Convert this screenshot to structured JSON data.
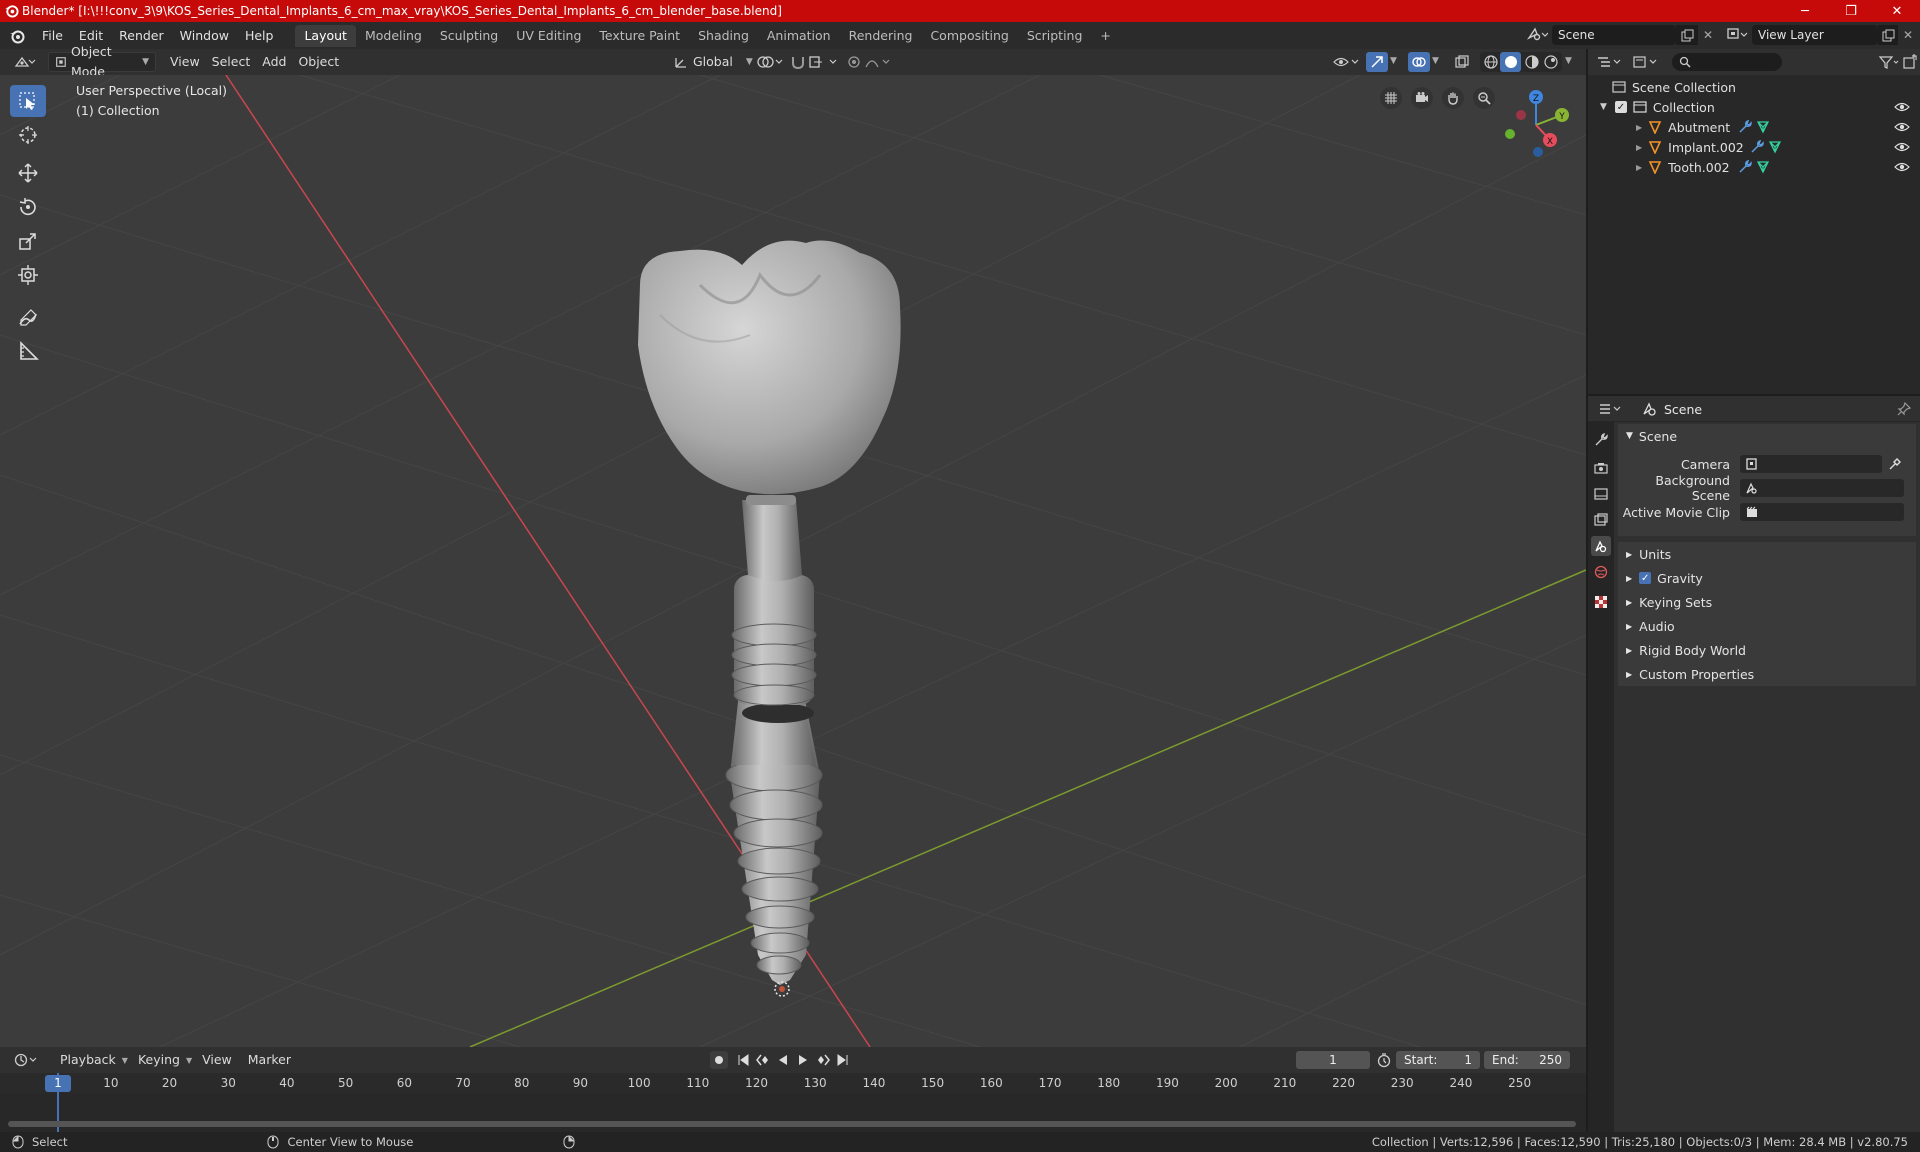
{
  "window": {
    "title": "Blender* [I:\\!!!conv_3\\9\\KOS_Series_Dental_Implants_6_cm_max_vray\\KOS_Series_Dental_Implants_6_cm_blender_base.blend]",
    "minimize": "─",
    "maximize": "❐",
    "close": "✕"
  },
  "menubar": {
    "items": [
      "File",
      "Edit",
      "Render",
      "Window",
      "Help"
    ],
    "workspaces": [
      "Layout",
      "Modeling",
      "Sculpting",
      "UV Editing",
      "Texture Paint",
      "Shading",
      "Animation",
      "Rendering",
      "Compositing",
      "Scripting"
    ],
    "active_workspace": "Layout",
    "add_workspace": "+",
    "scene_label": "Scene",
    "view_layer_label": "View Layer"
  },
  "viewport_header": {
    "mode": "Object Mode",
    "menus": [
      "View",
      "Select",
      "Add",
      "Object"
    ],
    "transform_orientation": "Global"
  },
  "viewport": {
    "perspective_label": "User Perspective (Local)",
    "collection_label": "(1) Collection",
    "gizmo": {
      "z": "Z",
      "y": "Y",
      "x": "X"
    }
  },
  "outliner": {
    "root": "Scene Collection",
    "collection": "Collection",
    "objects": [
      "Abutment",
      "Implant.002",
      "Tooth.002"
    ]
  },
  "properties": {
    "context": "Scene",
    "panel_title": "Scene",
    "fields": [
      {
        "label": "Camera"
      },
      {
        "label": "Background Scene"
      },
      {
        "label": "Active Movie Clip"
      }
    ],
    "sections": [
      "Units",
      "Gravity",
      "Keying Sets",
      "Audio",
      "Rigid Body World",
      "Custom Properties"
    ],
    "gravity_enabled": true
  },
  "timeline": {
    "menus": [
      "Playback",
      "Keying",
      "View",
      "Marker"
    ],
    "current_frame": "1",
    "start_label": "Start:",
    "start": "1",
    "end_label": "End:",
    "end": "250",
    "ticks": [
      "1",
      "10",
      "20",
      "30",
      "40",
      "50",
      "60",
      "70",
      "80",
      "90",
      "100",
      "110",
      "120",
      "130",
      "140",
      "150",
      "160",
      "170",
      "180",
      "190",
      "200",
      "210",
      "220",
      "230",
      "240",
      "250"
    ]
  },
  "statusbar": {
    "left_hint": "Select",
    "mid_hint": "Center View to Mouse",
    "stats": "Collection | Verts:12,596 | Faces:12,590 | Tris:25,180 | Objects:0/3 | Mem: 28.4 MB | v2.80.75"
  },
  "colors": {
    "title_bar": "#c60a0a",
    "accent": "#4772b3",
    "x_axis": "#e74c5c",
    "y_axis": "#8ab534",
    "z_axis": "#3f86e0",
    "object_icon": "#f1922a",
    "modifier_icon": "#5b9be0",
    "mesh_icon": "#33d0a0"
  }
}
